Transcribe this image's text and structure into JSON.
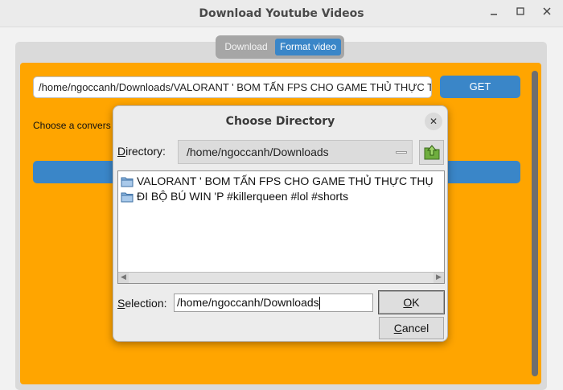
{
  "window": {
    "title": "Download Youtube Videos",
    "minimize_icon": "minimize-icon",
    "maximize_icon": "maximize-icon",
    "close_icon": "close-icon"
  },
  "tabs": [
    {
      "label": "Download",
      "selected": false
    },
    {
      "label": "Format video",
      "selected": true
    }
  ],
  "main": {
    "url_value": "/home/ngoccanh/Downloads/VALORANT ' BOM TẤN FPS CHO GAME THỦ THỰC TH",
    "get_label": "GET",
    "choose_label": "Choose a convers"
  },
  "dialog": {
    "title": "Choose Directory",
    "directory_label_prefix": "D",
    "directory_label_rest": "irectory:",
    "directory_value": "/home/ngoccanh/Downloads",
    "folders": [
      "VALORANT ' BOM TẤN FPS CHO GAME THỦ THỰC THỤ",
      "ĐI BỘ BÚ WIN 'P #killerqueen #lol #shorts"
    ],
    "selection_label_prefix": "S",
    "selection_label_rest": "election:",
    "selection_value": "/home/ngoccanh/Downloads",
    "ok_prefix": "O",
    "ok_rest": "K",
    "cancel_prefix": "C",
    "cancel_rest": "ancel"
  },
  "colors": {
    "panel": "#ffa500",
    "accent": "#3a86c8",
    "background": "#f2f2f2"
  }
}
